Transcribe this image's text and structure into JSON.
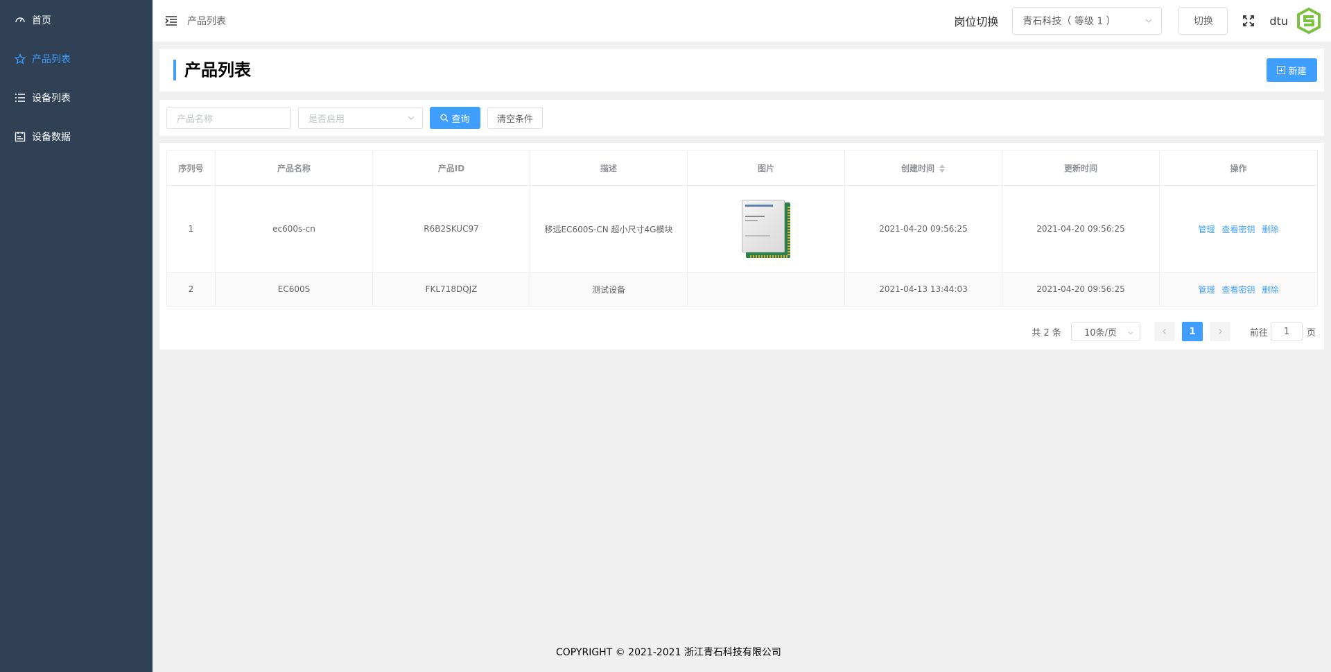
{
  "sidebar": {
    "items": [
      {
        "label": "首页",
        "icon": "dashboard-icon"
      },
      {
        "label": "产品列表",
        "icon": "star-icon",
        "active": true
      },
      {
        "label": "设备列表",
        "icon": "list-icon"
      },
      {
        "label": "设备数据",
        "icon": "calendar-icon"
      }
    ],
    "bg_color": "#304156",
    "active_color": "#409eff"
  },
  "header": {
    "breadcrumb": "产品列表",
    "post_label": "岗位切换",
    "post_select_value": "青石科技（ 等级 1 ）",
    "switch_label": "切换",
    "username": "dtu"
  },
  "page": {
    "title": "产品列表",
    "new_button": "新建"
  },
  "search": {
    "name_placeholder": "产品名称",
    "enabled_placeholder": "是否启用",
    "query_button": "查询",
    "clear_button": "清空条件"
  },
  "table": {
    "columns": [
      "序列号",
      "产品名称",
      "产品ID",
      "描述",
      "图片",
      "创建时间",
      "更新时间",
      "操作"
    ],
    "rows": [
      {
        "index": "1",
        "name": "ec600s-cn",
        "product_id": "R6B2SKUC97",
        "desc": "移远EC600S-CN 超小尺寸4G模块",
        "has_image": true,
        "created": "2021-04-20 09:56:25",
        "updated": "2021-04-20 09:56:25"
      },
      {
        "index": "2",
        "name": "EC600S",
        "product_id": "FKL718DQJZ",
        "desc": "测试设备",
        "has_image": false,
        "created": "2021-04-13 13:44:03",
        "updated": "2021-04-20 09:56:25"
      }
    ],
    "actions": [
      "管理",
      "查看密钥",
      "删除"
    ]
  },
  "pagination": {
    "total": "共 2 条",
    "page_size": "10条/页",
    "current_page": "1",
    "goto_label": "前往",
    "goto_value": "1",
    "goto_suffix": "页"
  },
  "footer": "COPYRIGHT © 2021-2021 浙江青石科技有限公司",
  "colors": {
    "primary": "#409eff",
    "logo_green": "#7cc242"
  }
}
